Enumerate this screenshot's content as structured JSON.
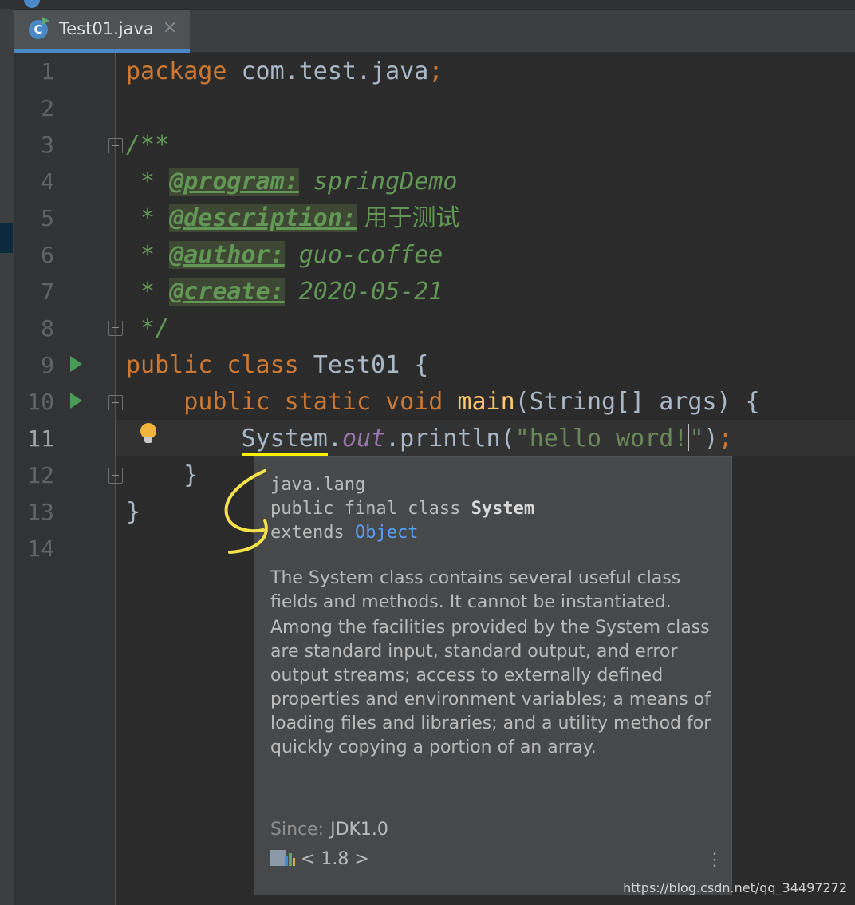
{
  "tab": {
    "label": "Test01.java",
    "icon_letter": "C",
    "close_glyph": "×"
  },
  "editor": {
    "line_numbers": [
      "1",
      "2",
      "3",
      "4",
      "5",
      "6",
      "7",
      "8",
      "9",
      "10",
      "11",
      "12",
      "13",
      "14"
    ],
    "current_line": "11",
    "code": {
      "l1_kw": "package",
      "l1_rest": " com.test.java",
      "l1_semi": ";",
      "l3": "/**",
      "l4_star": " * ",
      "l4_tag": "@program:",
      "l4_val": " springDemo",
      "l5_star": " * ",
      "l5_tag": "@description:",
      "l5_val": " 用于测试",
      "l6_star": " * ",
      "l6_tag": "@author:",
      "l6_val": " guo-coffee",
      "l7_star": " * ",
      "l7_tag": "@create:",
      "l7_val": " 2020-05-21",
      "l8": " */",
      "l9_kw": "public class ",
      "l9_rest": "Test01 {",
      "l10_kw": "    public static void ",
      "l10_fn": "main",
      "l10_rest": "(String[] args) {",
      "l11_indent": "        ",
      "l11_sys": "System",
      "l11_dot": ".",
      "l11_field": "out",
      "l11_call": ".println(",
      "l11_str1": "\"hello word!",
      "l11_str2": "\"",
      "l11_end": ")",
      "l11_semi": ";",
      "l12": "    }",
      "l13": "}"
    }
  },
  "popup": {
    "package": "java.lang",
    "decl_prefix": "public final class ",
    "decl_class": "System",
    "extends_prefix": "extends ",
    "extends_link": "Object",
    "desc1": "The System class contains several useful class fields and methods. It cannot be instantiated.",
    "desc2": "Among the facilities provided by the System class are standard input, standard output, and error output streams; access to externally defined properties and environment variables; a means of loading files and libraries; and a utility method for quickly copying a portion of an array.",
    "since_label": "Since:",
    "since_value": "JDK1.0",
    "library": "< 1.8 >",
    "menu_glyph": "⋮"
  },
  "watermark": "https://blog.csdn.net/qq_34497272",
  "colors": {
    "keyword": "#cc7832",
    "doc_comment": "#629755",
    "string": "#6a8759",
    "function": "#ffc66d",
    "static_field": "#9876aa",
    "link": "#589df6",
    "highlight_underline": "#fff200",
    "run_icon": "#499c54"
  }
}
